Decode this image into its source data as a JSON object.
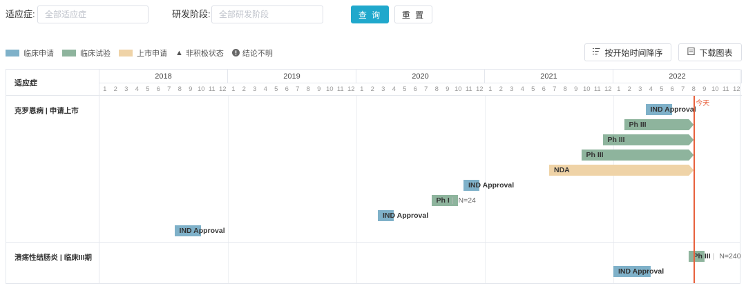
{
  "filters": {
    "indication_label": "适应症:",
    "indication_placeholder": "全部适应症",
    "stage_label": "研发阶段:",
    "stage_placeholder": "全部研发阶段",
    "query_button": "查 询",
    "reset_button": "重 置"
  },
  "legend": {
    "items": [
      {
        "label": "临床申请",
        "color": "#7fb1c9"
      },
      {
        "label": "临床试验",
        "color": "#8eb49d"
      },
      {
        "label": "上市申请",
        "color": "#efd3a7"
      }
    ],
    "inactive_label": "非积极状态",
    "inactive_icon": "triangle-icon",
    "unclear_label": "结论不明",
    "unclear_icon": "exclamation-circle-icon"
  },
  "toolbar": {
    "sort_button": "按开始时间降序",
    "sort_icon": "sort-list-icon",
    "download_button": "下载图表",
    "download_icon": "document-icon"
  },
  "timeline": {
    "indication_header": "适应症",
    "years": [
      "2018",
      "2019",
      "2020",
      "2021",
      "2022"
    ],
    "months": [
      "1",
      "2",
      "3",
      "4",
      "5",
      "6",
      "7",
      "8",
      "9",
      "10",
      "11",
      "12"
    ],
    "today_label": "今天",
    "today": "2022-08",
    "rows": [
      {
        "label": "克罗恩病 | 申请上市",
        "bars": [
          {
            "label": "IND Approval",
            "type": "clinical_application",
            "start": "2022-04",
            "end": "2022-06",
            "extra": ""
          },
          {
            "label": "Ph III",
            "type": "clinical_trial",
            "start": "2022-02",
            "end": "2022-08",
            "extra": ""
          },
          {
            "label": "Ph III",
            "type": "clinical_trial",
            "start": "2021-12",
            "end": "2022-08",
            "extra": ""
          },
          {
            "label": "Ph III",
            "type": "clinical_trial",
            "start": "2021-10",
            "end": "2022-08",
            "extra": ""
          },
          {
            "label": "NDA",
            "type": "market_application",
            "start": "2021-07",
            "end": "2022-08",
            "extra": ""
          },
          {
            "label": "IND Approval",
            "type": "clinical_application",
            "start": "2020-11",
            "end": "2020-12",
            "extra": ""
          },
          {
            "label": "Ph I",
            "type": "clinical_trial",
            "start": "2020-08",
            "end": "2020-10",
            "extra": "N=24"
          },
          {
            "label": "IND Approval",
            "type": "clinical_application",
            "start": "2020-03",
            "end": "2020-04",
            "extra": ""
          },
          {
            "label": "IND Approval",
            "type": "clinical_application",
            "start": "2018-08",
            "end": "2018-10",
            "extra": ""
          }
        ]
      },
      {
        "label": "溃疡性结肠炎 | 临床III期",
        "bars": [
          {
            "label": "Ph III",
            "type": "clinical_trial",
            "start": "2022-08",
            "end": "2022-09",
            "extra": "N=240"
          },
          {
            "label": "IND Approval",
            "type": "clinical_application",
            "start": "2022-01",
            "end": "2022-04",
            "extra": ""
          }
        ]
      }
    ]
  }
}
